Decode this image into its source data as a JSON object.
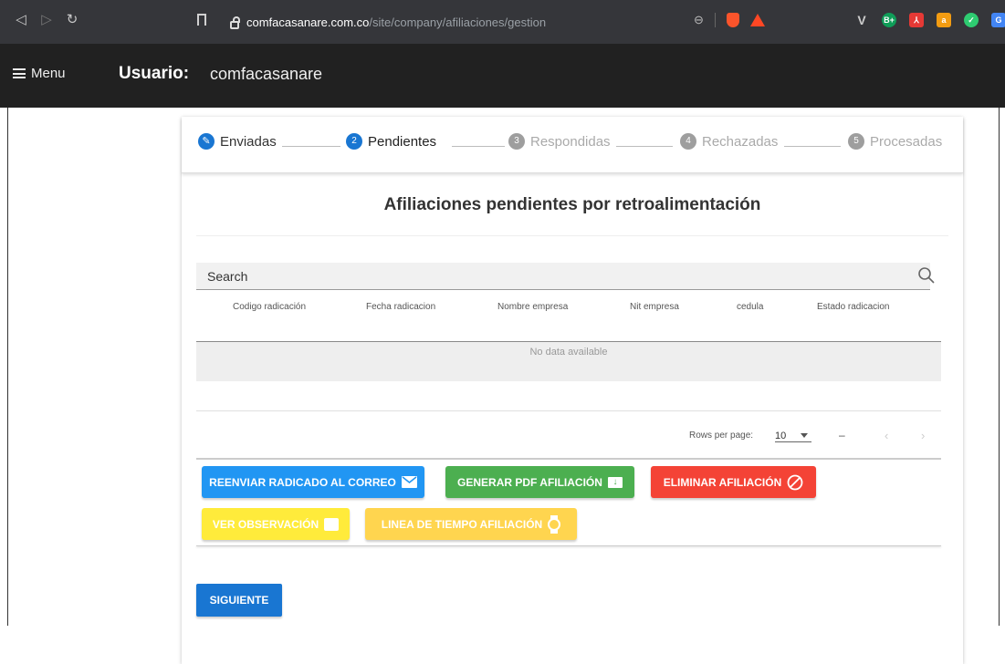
{
  "browser": {
    "url_domain": "comfacasanare.com.co",
    "url_path": "/site/company/afiliaciones/gestion",
    "back_icon": "back-arrow-icon",
    "forward_icon": "forward-arrow-icon",
    "reload_icon": "reload-icon"
  },
  "appbar": {
    "menu_label": "Menu",
    "user_label": "Usuario:",
    "user_value": "comfacasanare"
  },
  "stepper": {
    "steps": [
      {
        "label": "Enviadas",
        "number": "",
        "active": true,
        "color": "#1976d2"
      },
      {
        "label": "Pendientes",
        "number": "2",
        "active": true,
        "color": "#1976d2"
      },
      {
        "label": "Respondidas",
        "number": "3",
        "active": false,
        "color": "#9e9e9e"
      },
      {
        "label": "Rechazadas",
        "number": "4",
        "active": false,
        "color": "#9e9e9e"
      },
      {
        "label": "Procesadas",
        "number": "5",
        "active": false,
        "color": "#9e9e9e"
      }
    ]
  },
  "main": {
    "title": "Afiliaciones pendientes por retroalimentación",
    "search_placeholder": "Search",
    "columns": [
      "Codigo radicación",
      "Fecha radicacion",
      "Nombre empresa",
      "Nit empresa",
      "cedula",
      "Estado radicacion"
    ],
    "no_data": "No data available",
    "rows_per_page_label": "Rows per page:",
    "rows_per_page_value": "10",
    "page_range": "–",
    "prev_icon": "chevron-left-icon",
    "next_icon": "chevron-right-icon"
  },
  "actions": {
    "reenviar": "REENVIAR RADICADO AL CORREO",
    "generar_pdf": "GENERAR PDF AFILIACIÓN",
    "eliminar": "ELIMINAR AFILIACIÓN",
    "ver_observacion": "VER OBSERVACIÓN",
    "linea_tiempo": "LINEA DE TIEMPO AFILIACIÓN",
    "siguiente": "SIGUIENTE"
  },
  "colors": {
    "primary": "#1976d2",
    "blue_btn": "#2196f3",
    "green_btn": "#4caf50",
    "red_btn": "#f44336",
    "yellow_btn": "#ffeb3b",
    "yellow_alt": "#ffd54f"
  }
}
